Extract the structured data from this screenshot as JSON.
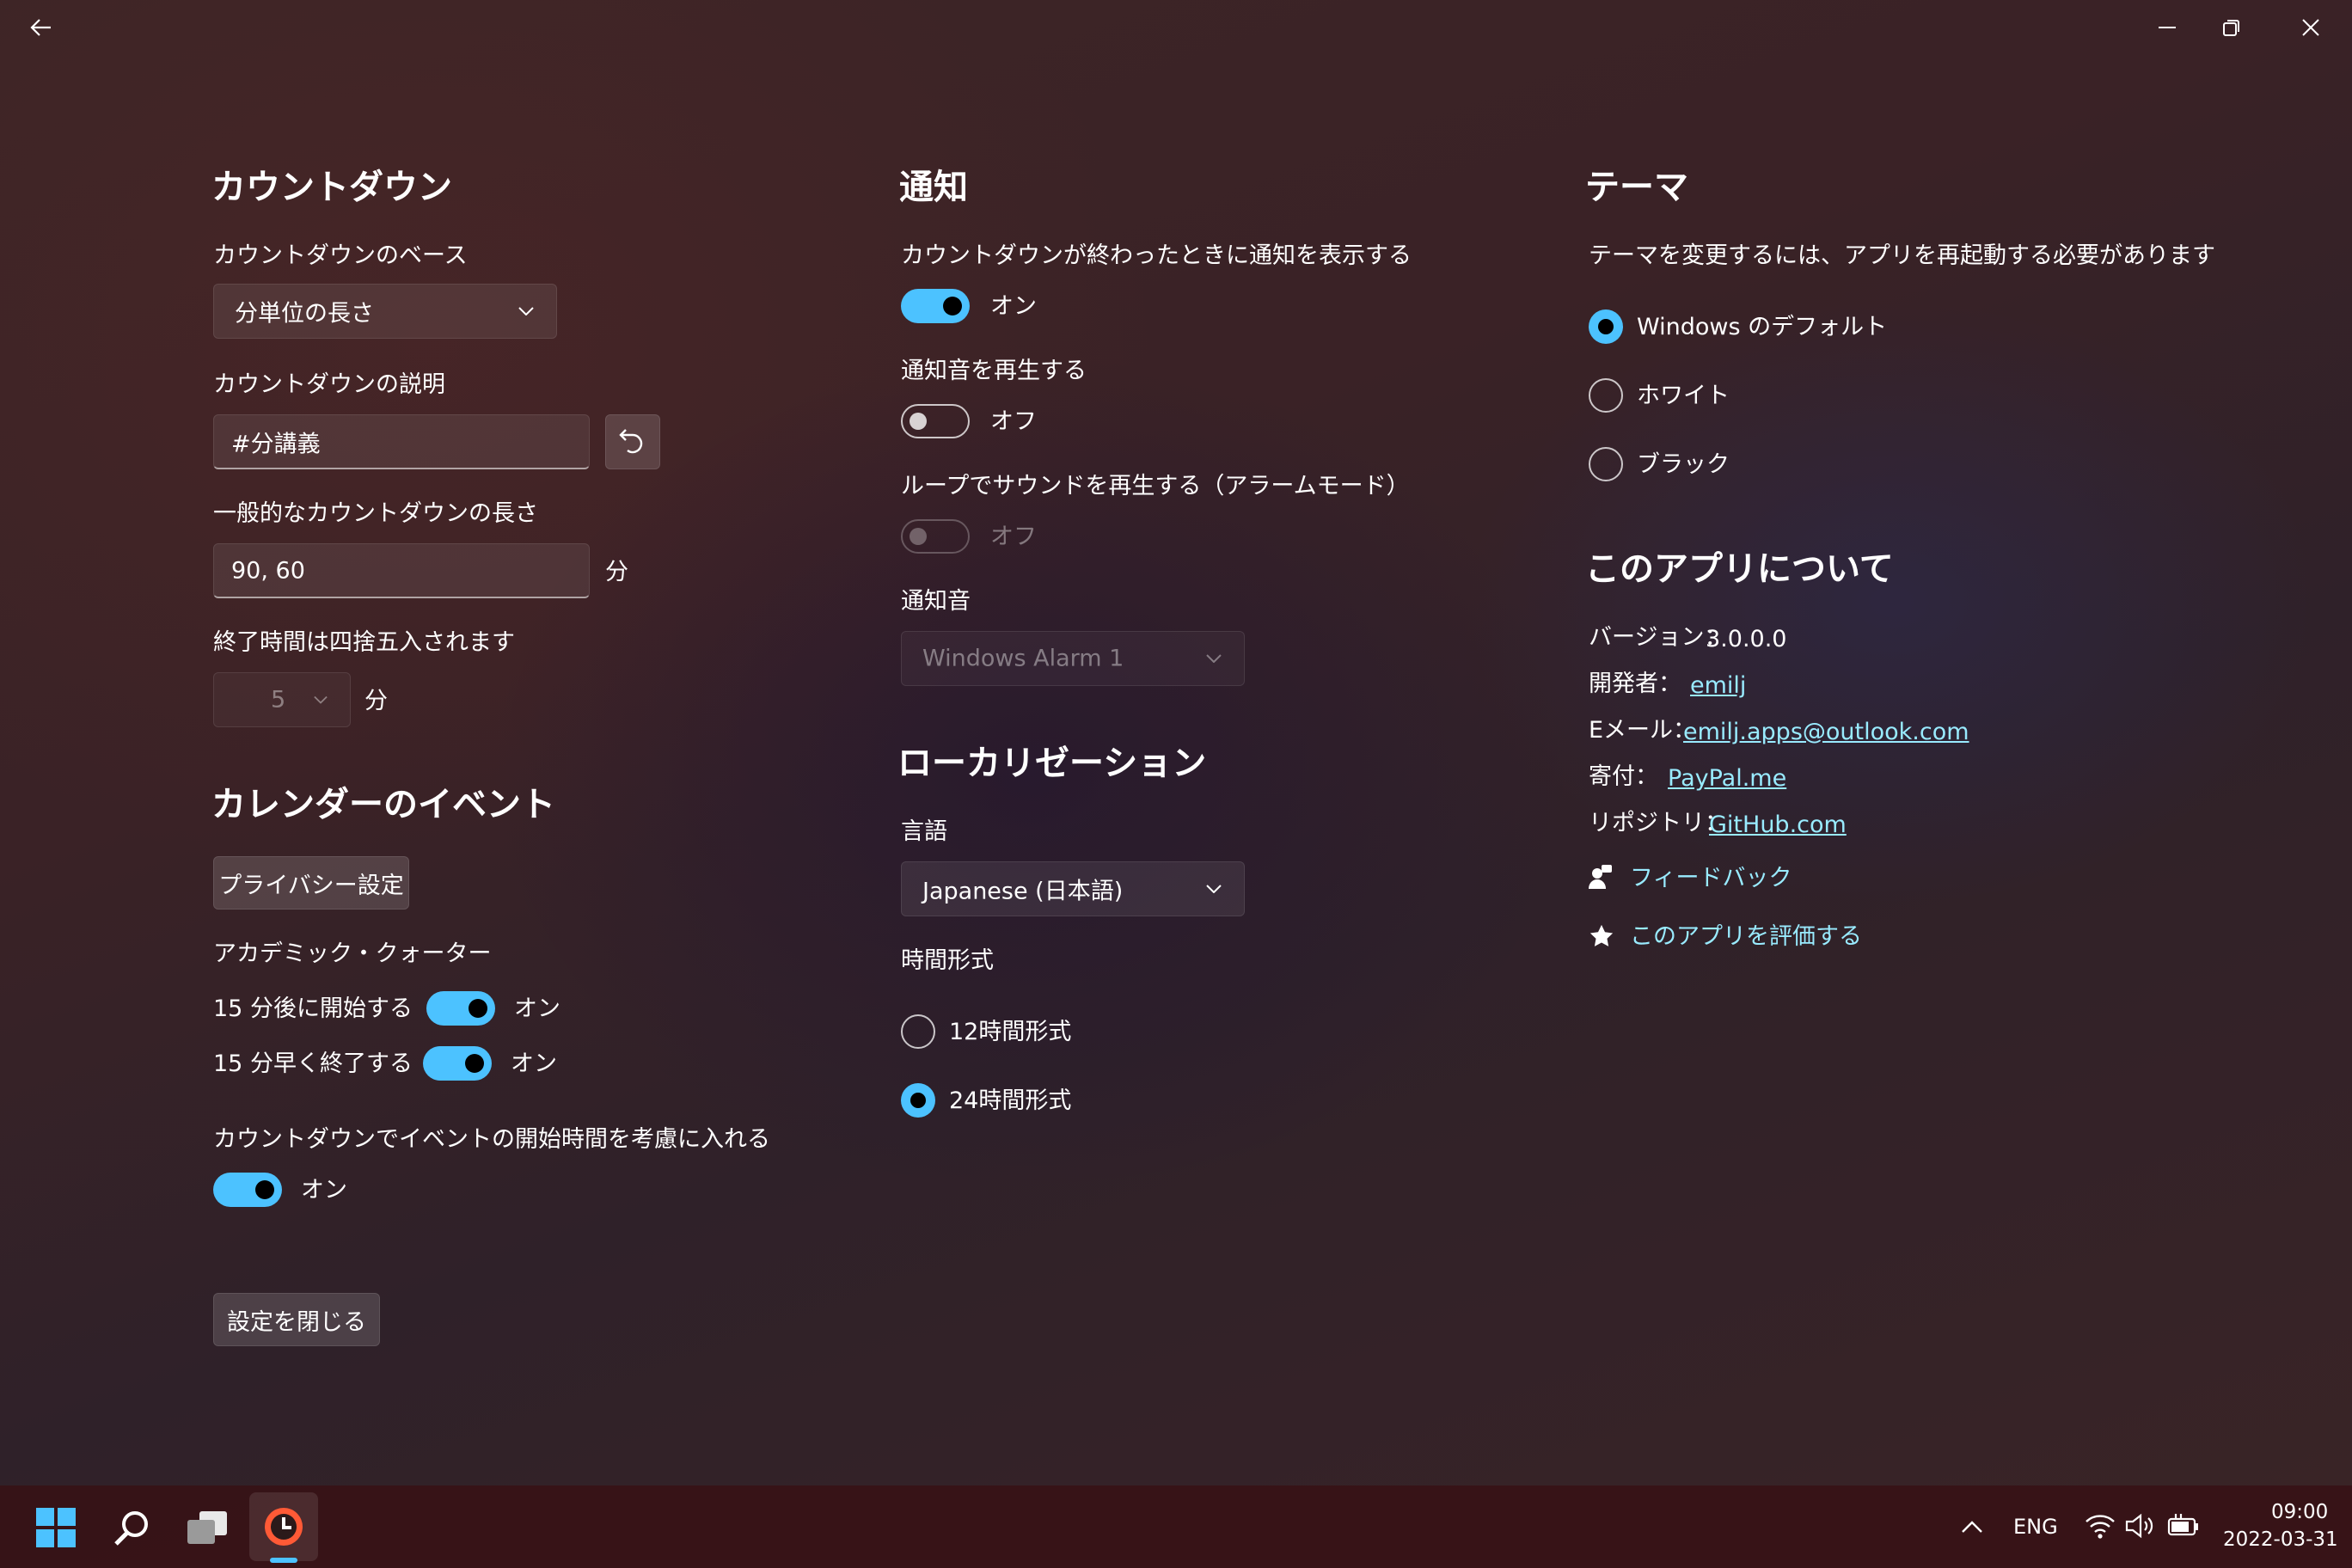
{
  "colors": {
    "accent": "#4cc2ff",
    "link": "#99ebff"
  },
  "countdown": {
    "heading": "カウントダウン",
    "base_label": "カウントダウンのベース",
    "base_value": "分単位の長さ",
    "desc_label": "カウントダウンの説明",
    "desc_value": "#分講義",
    "length_label": "一般的なカウントダウンの長さ",
    "length_value": "90, 60",
    "length_unit": "分",
    "round_label": "終了時間は四捨五入されます",
    "round_value": "5",
    "round_unit": "分"
  },
  "calendar": {
    "heading": "カレンダーのイベント",
    "privacy_button": "プライバシー設定",
    "academic_label": "アカデミック・クォーター",
    "start_label": "15 分後に開始する",
    "start_state": "オン",
    "end_label": "15 分早く終了する",
    "end_state": "オン",
    "consider_label": "カウントダウンでイベントの開始時間を考慮に入れる",
    "consider_state": "オン"
  },
  "close_button": "設定を閉じる",
  "notifications": {
    "heading": "通知",
    "show_label": "カウントダウンが終わったときに通知を表示する",
    "show_state": "オン",
    "sound_label": "通知音を再生する",
    "sound_state": "オフ",
    "loop_label": "ループでサウンドを再生する（アラームモード）",
    "loop_state": "オフ",
    "tone_label": "通知音",
    "tone_value": "Windows Alarm 1"
  },
  "localization": {
    "heading": "ローカリゼーション",
    "language_label": "言語",
    "language_value": "Japanese (日本語)",
    "time_label": "時間形式",
    "opt12": "12時間形式",
    "opt24": "24時間形式"
  },
  "theme": {
    "heading": "テーマ",
    "note": "テーマを変更するには、アプリを再起動する必要があります",
    "opt_default": "Windows のデフォルト",
    "opt_white": "ホワイト",
    "opt_black": "ブラック"
  },
  "about": {
    "heading": "このアプリについて",
    "version_label": "バージョン：",
    "version_value": "3.0.0.0",
    "dev_label": "開発者：",
    "dev_value": "emilj",
    "email_label": "Eメール：",
    "email_value": "emilj.apps@outlook.com",
    "donate_label": "寄付：",
    "donate_value": "PayPal.me",
    "repo_label": "リポジトリ：",
    "repo_value": "GitHub.com",
    "feedback": "フィードバック",
    "rate": "このアプリを評価する"
  },
  "taskbar": {
    "lang": "ENG",
    "time": "09:00",
    "date": "2022-03-31"
  },
  "icons": [
    "back-arrow-icon",
    "minimize-icon",
    "restore-icon",
    "close-icon",
    "chevron-down-icon",
    "undo-icon",
    "feedback-icon",
    "star-icon",
    "start-icon",
    "search-icon",
    "task-view-icon",
    "app-icon",
    "chevron-up-icon",
    "wifi-icon",
    "volume-icon",
    "battery-icon"
  ]
}
